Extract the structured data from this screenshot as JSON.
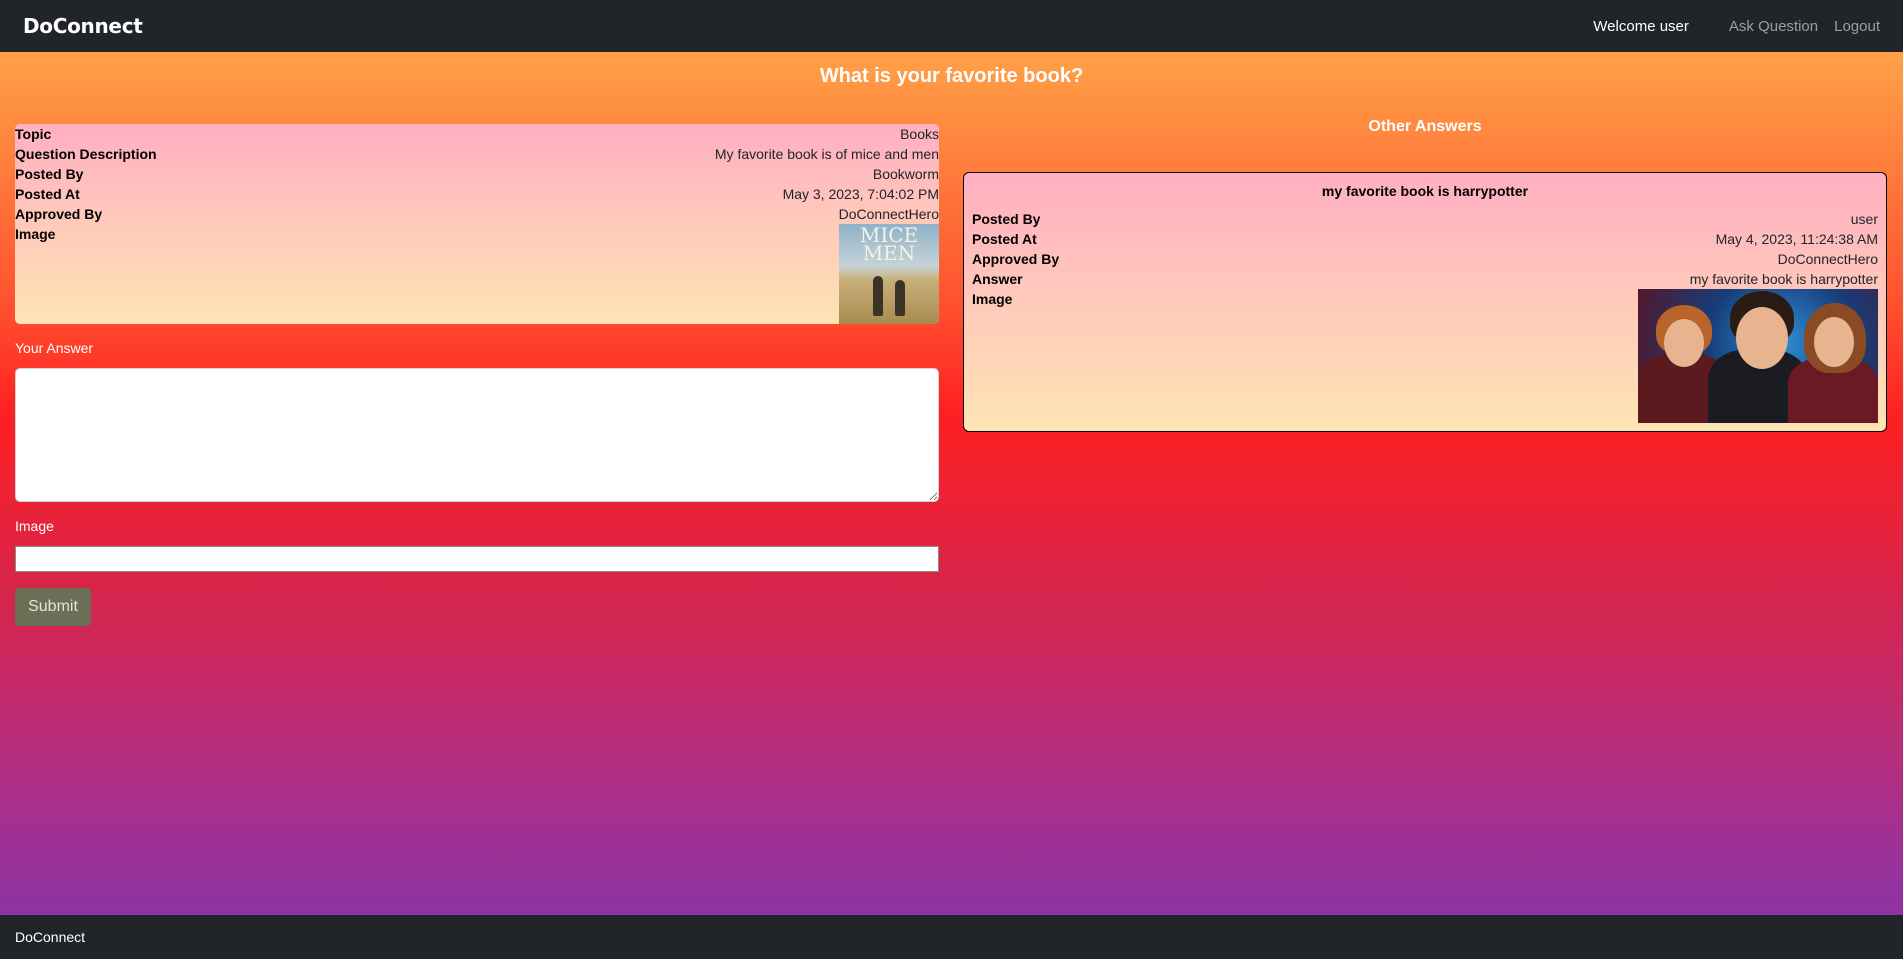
{
  "navbar": {
    "brand": "DoConnect",
    "welcome": "Welcome user",
    "ask_question": "Ask Question",
    "logout": "Logout"
  },
  "question": {
    "title": "What is your favorite book?",
    "fields": [
      {
        "label": "Topic",
        "value": "Books"
      },
      {
        "label": "Question Description",
        "value": "My favorite book is of mice and men"
      },
      {
        "label": "Posted By",
        "value": "Bookworm"
      },
      {
        "label": "Posted At",
        "value": "May 3, 2023, 7:04:02 PM"
      },
      {
        "label": "Approved By",
        "value": "DoConnectHero"
      }
    ],
    "image_label": "Image",
    "image_cover_text": "MICE MEN"
  },
  "answer_form": {
    "answer_label": "Your Answer",
    "answer_value": "",
    "image_label": "Image",
    "image_value": "",
    "submit_label": "Submit"
  },
  "other_answers": {
    "heading": "Other Answers",
    "items": [
      {
        "title": "my favorite book is harrypotter",
        "fields": [
          {
            "label": "Posted By",
            "value": "user"
          },
          {
            "label": "Posted At",
            "value": "May 4, 2023, 11:24:38 AM"
          },
          {
            "label": "Approved By",
            "value": "DoConnectHero"
          },
          {
            "label": "Answer",
            "value": "my favorite book is harrypotter"
          }
        ],
        "image_label": "Image"
      }
    ]
  },
  "footer": {
    "brand": "DoConnect"
  },
  "colors": {
    "navbar": "#212529",
    "submit_button": "#6b6f55",
    "gradient_top": "#ffa147",
    "gradient_mid": "#ff1f21",
    "gradient_bottom": "#8e33a6"
  }
}
